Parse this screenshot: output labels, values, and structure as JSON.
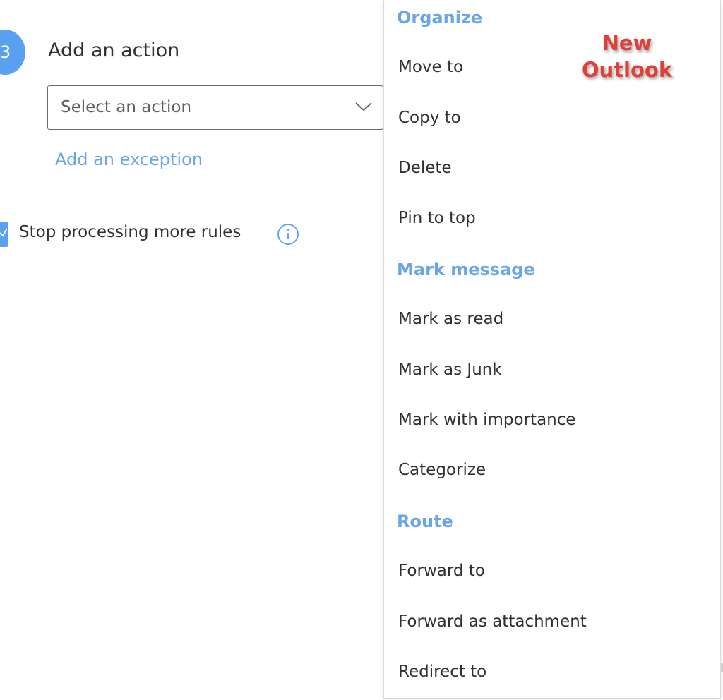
{
  "rule_step": {
    "number": "3",
    "title": "Add an action",
    "action_select": {
      "placeholder": "Select an action"
    },
    "exception_link": "Add an exception",
    "stop_processing": {
      "label": "Stop processing more rules",
      "checked": true
    }
  },
  "menu": {
    "groups": [
      {
        "header": "Organize",
        "items": [
          "Move to",
          "Copy to",
          "Delete",
          "Pin to top"
        ]
      },
      {
        "header": "Mark message",
        "items": [
          "Mark as read",
          "Mark as Junk",
          "Mark with importance",
          "Categorize"
        ]
      },
      {
        "header": "Route",
        "items": [
          "Forward to",
          "Forward as attachment",
          "Redirect to"
        ]
      }
    ]
  },
  "annotation": {
    "line1": "New",
    "line2": "Outlook"
  },
  "colors": {
    "accent": "#5aa0f0",
    "link": "#6aa5ea",
    "annotation": "#e0403a"
  }
}
